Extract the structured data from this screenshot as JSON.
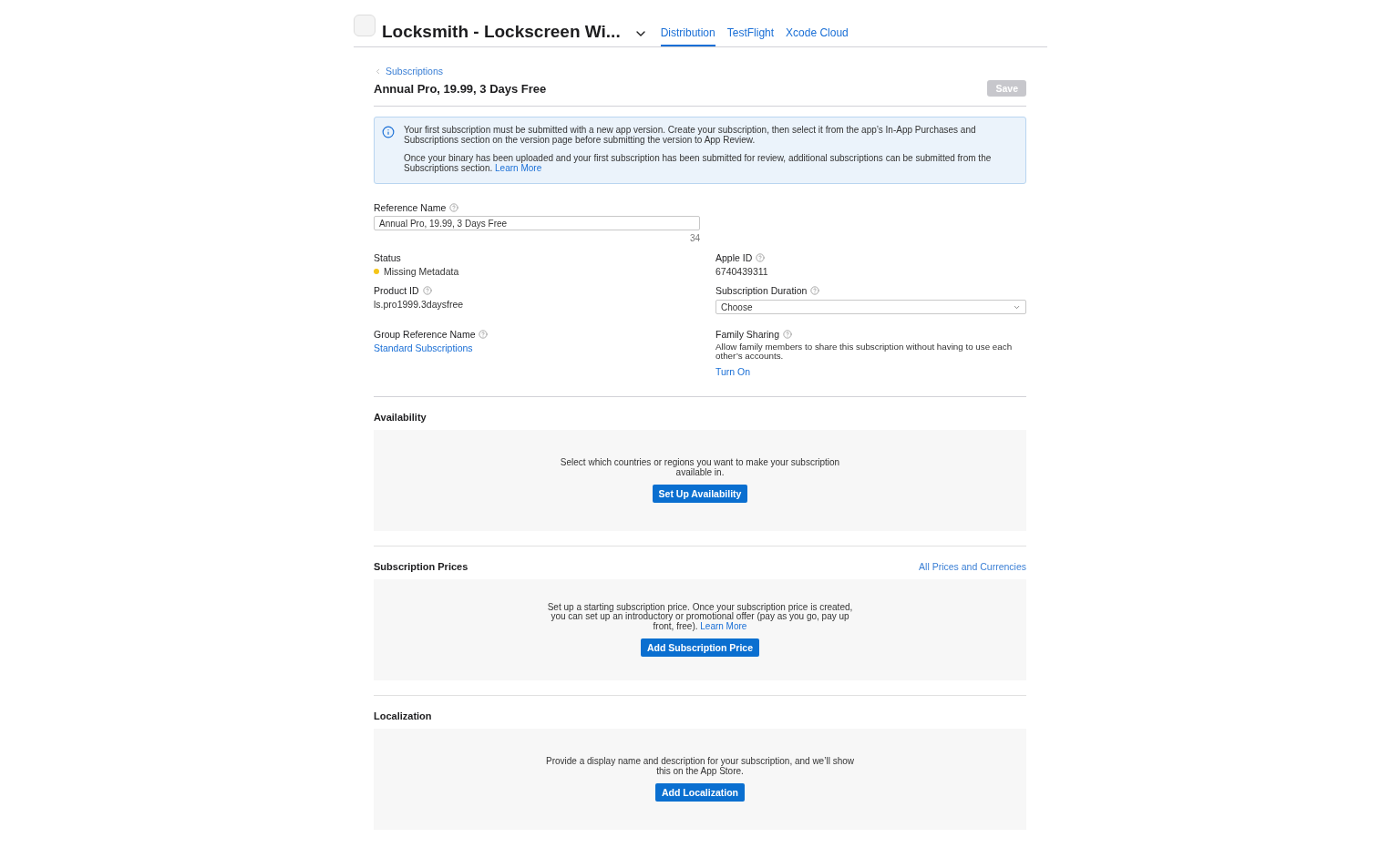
{
  "header": {
    "app_name": "Locksmith - Lockscreen Wi...",
    "tabs": [
      {
        "label": "Distribution",
        "selected": true
      },
      {
        "label": "TestFlight",
        "selected": false
      },
      {
        "label": "Xcode Cloud",
        "selected": false
      }
    ]
  },
  "breadcrumb": "Subscriptions",
  "title": "Annual Pro, 19.99, 3 Days Free",
  "save": {
    "label": "Save",
    "disabled": true
  },
  "notice": {
    "paragraphs": [
      "Your first subscription must be submitted with a new app version. Create your subscription, then select it from the app’s In-App Purchases and Subscriptions section on the version page before submitting the version to App Review.",
      "Once your binary has been uploaded and your first subscription has been submitted for review, additional subscriptions can be submitted from the Subscriptions section."
    ],
    "link": "Learn More"
  },
  "reference_name": {
    "label": "Reference Name",
    "help": true,
    "value": "Annual Pro, 19.99, 3 Days Free",
    "count": "34"
  },
  "left_fields": [
    {
      "kind": "status",
      "label": "Status",
      "help": false,
      "value": "Missing Metadata",
      "color": "#f5c518"
    },
    {
      "kind": "text",
      "label": "Product ID",
      "help": true,
      "value": "ls.pro1999.3daysfree"
    },
    {
      "kind": "link",
      "label": "Group Reference Name",
      "help": true,
      "value": "Standard Subscriptions"
    }
  ],
  "right_fields": [
    {
      "kind": "text",
      "label": "Apple ID",
      "help": true,
      "value": "6740439311"
    },
    {
      "kind": "select",
      "label": "Subscription Duration",
      "help": true,
      "value": "Choose"
    },
    {
      "kind": "toggle",
      "label": "Family Sharing",
      "help": true,
      "value": "Allow family members to share this subscription without having to use each other’s accounts.",
      "link": "Turn On"
    }
  ],
  "sections": [
    {
      "title": "Availability",
      "text": "Select which countries or regions you want to make your subscription available in.",
      "button": "Set Up Availability"
    },
    {
      "title": "Subscription Prices",
      "header_link": "All Prices and Currencies",
      "text": "Set up a starting subscription price. Once your subscription price is created, you can set up an introductory or promotional offer (pay as you go, pay up front, free).",
      "link": "Learn More",
      "button": "Add Subscription Price"
    },
    {
      "title": "Localization",
      "text": "Provide a display name and description for your subscription, and we’ll show this on the App Store.",
      "button": "Add Localization"
    }
  ]
}
